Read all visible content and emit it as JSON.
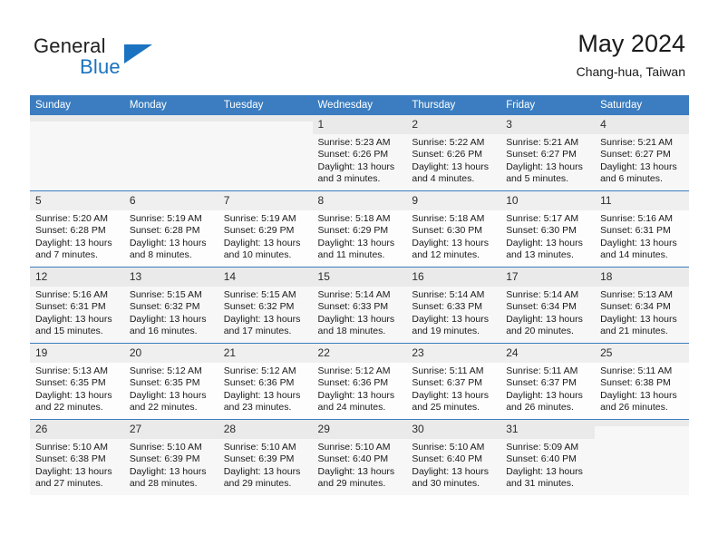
{
  "brand": {
    "name_part1": "General",
    "name_part2": "Blue",
    "accent_color": "#1b72c0"
  },
  "header": {
    "title": "May 2024",
    "subtitle": "Chang-hua, Taiwan"
  },
  "calendar": {
    "header_bg": "#3b7dc0",
    "weekday_headers": [
      "Sunday",
      "Monday",
      "Tuesday",
      "Wednesday",
      "Thursday",
      "Friday",
      "Saturday"
    ],
    "weeks": [
      {
        "shaded": true,
        "days": [
          {
            "day": "",
            "empty": true,
            "sunrise": "",
            "sunset": "",
            "daylight_line1": "",
            "daylight_line2": ""
          },
          {
            "day": "",
            "empty": true,
            "sunrise": "",
            "sunset": "",
            "daylight_line1": "",
            "daylight_line2": ""
          },
          {
            "day": "",
            "empty": true,
            "sunrise": "",
            "sunset": "",
            "daylight_line1": "",
            "daylight_line2": ""
          },
          {
            "day": "1",
            "empty": false,
            "sunrise": "Sunrise: 5:23 AM",
            "sunset": "Sunset: 6:26 PM",
            "daylight_line1": "Daylight: 13 hours",
            "daylight_line2": "and 3 minutes."
          },
          {
            "day": "2",
            "empty": false,
            "sunrise": "Sunrise: 5:22 AM",
            "sunset": "Sunset: 6:26 PM",
            "daylight_line1": "Daylight: 13 hours",
            "daylight_line2": "and 4 minutes."
          },
          {
            "day": "3",
            "empty": false,
            "sunrise": "Sunrise: 5:21 AM",
            "sunset": "Sunset: 6:27 PM",
            "daylight_line1": "Daylight: 13 hours",
            "daylight_line2": "and 5 minutes."
          },
          {
            "day": "4",
            "empty": false,
            "sunrise": "Sunrise: 5:21 AM",
            "sunset": "Sunset: 6:27 PM",
            "daylight_line1": "Daylight: 13 hours",
            "daylight_line2": "and 6 minutes."
          }
        ]
      },
      {
        "shaded": false,
        "days": [
          {
            "day": "5",
            "empty": false,
            "sunrise": "Sunrise: 5:20 AM",
            "sunset": "Sunset: 6:28 PM",
            "daylight_line1": "Daylight: 13 hours",
            "daylight_line2": "and 7 minutes."
          },
          {
            "day": "6",
            "empty": false,
            "sunrise": "Sunrise: 5:19 AM",
            "sunset": "Sunset: 6:28 PM",
            "daylight_line1": "Daylight: 13 hours",
            "daylight_line2": "and 8 minutes."
          },
          {
            "day": "7",
            "empty": false,
            "sunrise": "Sunrise: 5:19 AM",
            "sunset": "Sunset: 6:29 PM",
            "daylight_line1": "Daylight: 13 hours",
            "daylight_line2": "and 10 minutes."
          },
          {
            "day": "8",
            "empty": false,
            "sunrise": "Sunrise: 5:18 AM",
            "sunset": "Sunset: 6:29 PM",
            "daylight_line1": "Daylight: 13 hours",
            "daylight_line2": "and 11 minutes."
          },
          {
            "day": "9",
            "empty": false,
            "sunrise": "Sunrise: 5:18 AM",
            "sunset": "Sunset: 6:30 PM",
            "daylight_line1": "Daylight: 13 hours",
            "daylight_line2": "and 12 minutes."
          },
          {
            "day": "10",
            "empty": false,
            "sunrise": "Sunrise: 5:17 AM",
            "sunset": "Sunset: 6:30 PM",
            "daylight_line1": "Daylight: 13 hours",
            "daylight_line2": "and 13 minutes."
          },
          {
            "day": "11",
            "empty": false,
            "sunrise": "Sunrise: 5:16 AM",
            "sunset": "Sunset: 6:31 PM",
            "daylight_line1": "Daylight: 13 hours",
            "daylight_line2": "and 14 minutes."
          }
        ]
      },
      {
        "shaded": true,
        "days": [
          {
            "day": "12",
            "empty": false,
            "sunrise": "Sunrise: 5:16 AM",
            "sunset": "Sunset: 6:31 PM",
            "daylight_line1": "Daylight: 13 hours",
            "daylight_line2": "and 15 minutes."
          },
          {
            "day": "13",
            "empty": false,
            "sunrise": "Sunrise: 5:15 AM",
            "sunset": "Sunset: 6:32 PM",
            "daylight_line1": "Daylight: 13 hours",
            "daylight_line2": "and 16 minutes."
          },
          {
            "day": "14",
            "empty": false,
            "sunrise": "Sunrise: 5:15 AM",
            "sunset": "Sunset: 6:32 PM",
            "daylight_line1": "Daylight: 13 hours",
            "daylight_line2": "and 17 minutes."
          },
          {
            "day": "15",
            "empty": false,
            "sunrise": "Sunrise: 5:14 AM",
            "sunset": "Sunset: 6:33 PM",
            "daylight_line1": "Daylight: 13 hours",
            "daylight_line2": "and 18 minutes."
          },
          {
            "day": "16",
            "empty": false,
            "sunrise": "Sunrise: 5:14 AM",
            "sunset": "Sunset: 6:33 PM",
            "daylight_line1": "Daylight: 13 hours",
            "daylight_line2": "and 19 minutes."
          },
          {
            "day": "17",
            "empty": false,
            "sunrise": "Sunrise: 5:14 AM",
            "sunset": "Sunset: 6:34 PM",
            "daylight_line1": "Daylight: 13 hours",
            "daylight_line2": "and 20 minutes."
          },
          {
            "day": "18",
            "empty": false,
            "sunrise": "Sunrise: 5:13 AM",
            "sunset": "Sunset: 6:34 PM",
            "daylight_line1": "Daylight: 13 hours",
            "daylight_line2": "and 21 minutes."
          }
        ]
      },
      {
        "shaded": false,
        "days": [
          {
            "day": "19",
            "empty": false,
            "sunrise": "Sunrise: 5:13 AM",
            "sunset": "Sunset: 6:35 PM",
            "daylight_line1": "Daylight: 13 hours",
            "daylight_line2": "and 22 minutes."
          },
          {
            "day": "20",
            "empty": false,
            "sunrise": "Sunrise: 5:12 AM",
            "sunset": "Sunset: 6:35 PM",
            "daylight_line1": "Daylight: 13 hours",
            "daylight_line2": "and 22 minutes."
          },
          {
            "day": "21",
            "empty": false,
            "sunrise": "Sunrise: 5:12 AM",
            "sunset": "Sunset: 6:36 PM",
            "daylight_line1": "Daylight: 13 hours",
            "daylight_line2": "and 23 minutes."
          },
          {
            "day": "22",
            "empty": false,
            "sunrise": "Sunrise: 5:12 AM",
            "sunset": "Sunset: 6:36 PM",
            "daylight_line1": "Daylight: 13 hours",
            "daylight_line2": "and 24 minutes."
          },
          {
            "day": "23",
            "empty": false,
            "sunrise": "Sunrise: 5:11 AM",
            "sunset": "Sunset: 6:37 PM",
            "daylight_line1": "Daylight: 13 hours",
            "daylight_line2": "and 25 minutes."
          },
          {
            "day": "24",
            "empty": false,
            "sunrise": "Sunrise: 5:11 AM",
            "sunset": "Sunset: 6:37 PM",
            "daylight_line1": "Daylight: 13 hours",
            "daylight_line2": "and 26 minutes."
          },
          {
            "day": "25",
            "empty": false,
            "sunrise": "Sunrise: 5:11 AM",
            "sunset": "Sunset: 6:38 PM",
            "daylight_line1": "Daylight: 13 hours",
            "daylight_line2": "and 26 minutes."
          }
        ]
      },
      {
        "shaded": true,
        "days": [
          {
            "day": "26",
            "empty": false,
            "sunrise": "Sunrise: 5:10 AM",
            "sunset": "Sunset: 6:38 PM",
            "daylight_line1": "Daylight: 13 hours",
            "daylight_line2": "and 27 minutes."
          },
          {
            "day": "27",
            "empty": false,
            "sunrise": "Sunrise: 5:10 AM",
            "sunset": "Sunset: 6:39 PM",
            "daylight_line1": "Daylight: 13 hours",
            "daylight_line2": "and 28 minutes."
          },
          {
            "day": "28",
            "empty": false,
            "sunrise": "Sunrise: 5:10 AM",
            "sunset": "Sunset: 6:39 PM",
            "daylight_line1": "Daylight: 13 hours",
            "daylight_line2": "and 29 minutes."
          },
          {
            "day": "29",
            "empty": false,
            "sunrise": "Sunrise: 5:10 AM",
            "sunset": "Sunset: 6:40 PM",
            "daylight_line1": "Daylight: 13 hours",
            "daylight_line2": "and 29 minutes."
          },
          {
            "day": "30",
            "empty": false,
            "sunrise": "Sunrise: 5:10 AM",
            "sunset": "Sunset: 6:40 PM",
            "daylight_line1": "Daylight: 13 hours",
            "daylight_line2": "and 30 minutes."
          },
          {
            "day": "31",
            "empty": false,
            "sunrise": "Sunrise: 5:09 AM",
            "sunset": "Sunset: 6:40 PM",
            "daylight_line1": "Daylight: 13 hours",
            "daylight_line2": "and 31 minutes."
          },
          {
            "day": "",
            "empty": true,
            "sunrise": "",
            "sunset": "",
            "daylight_line1": "",
            "daylight_line2": ""
          }
        ]
      }
    ]
  }
}
